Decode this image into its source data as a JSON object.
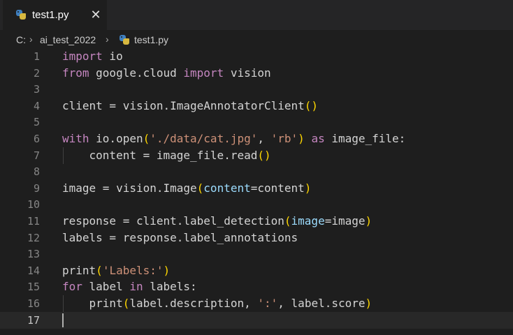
{
  "tab": {
    "label": "test1.py",
    "close_glyph": "✕",
    "icon": "python-file-icon"
  },
  "breadcrumb": {
    "drive": "C:",
    "separator": "›",
    "folder": "ai_test_2022",
    "file": "test1.py"
  },
  "colors": {
    "editor_background": "#1e1e1e",
    "tabbar_background": "#252526",
    "keyword": "#c586c0",
    "string": "#ce9178",
    "bracket": "#ffd700",
    "parameter": "#9cdcfe",
    "line_number": "#858585"
  },
  "editor": {
    "current_line": 17,
    "lines": [
      {
        "n": "1",
        "tokens": [
          {
            "t": "import",
            "c": "kw"
          },
          {
            "t": " io",
            "c": ""
          }
        ]
      },
      {
        "n": "2",
        "tokens": [
          {
            "t": "from",
            "c": "kw"
          },
          {
            "t": " google.cloud ",
            "c": ""
          },
          {
            "t": "import",
            "c": "kw"
          },
          {
            "t": " vision",
            "c": ""
          }
        ]
      },
      {
        "n": "3",
        "tokens": []
      },
      {
        "n": "4",
        "tokens": [
          {
            "t": "client = vision.ImageAnnotatorClient",
            "c": ""
          },
          {
            "t": "()",
            "c": "br"
          }
        ]
      },
      {
        "n": "5",
        "tokens": []
      },
      {
        "n": "6",
        "tokens": [
          {
            "t": "with",
            "c": "kw"
          },
          {
            "t": " io.open",
            "c": ""
          },
          {
            "t": "(",
            "c": "br"
          },
          {
            "t": "'./data/cat.jpg'",
            "c": "str"
          },
          {
            "t": ", ",
            "c": ""
          },
          {
            "t": "'rb'",
            "c": "str"
          },
          {
            "t": ")",
            "c": "br"
          },
          {
            "t": " ",
            "c": ""
          },
          {
            "t": "as",
            "c": "kw"
          },
          {
            "t": " image_file:",
            "c": ""
          }
        ]
      },
      {
        "n": "7",
        "tokens": [
          {
            "t": "    content = image_file.read",
            "c": ""
          },
          {
            "t": "()",
            "c": "br"
          }
        ],
        "guide": true
      },
      {
        "n": "8",
        "tokens": []
      },
      {
        "n": "9",
        "tokens": [
          {
            "t": "image = vision.Image",
            "c": ""
          },
          {
            "t": "(",
            "c": "br"
          },
          {
            "t": "content",
            "c": "id"
          },
          {
            "t": "=content",
            "c": ""
          },
          {
            "t": ")",
            "c": "br"
          }
        ]
      },
      {
        "n": "10",
        "tokens": []
      },
      {
        "n": "11",
        "tokens": [
          {
            "t": "response = client.label_detection",
            "c": ""
          },
          {
            "t": "(",
            "c": "br"
          },
          {
            "t": "image",
            "c": "id"
          },
          {
            "t": "=image",
            "c": ""
          },
          {
            "t": ")",
            "c": "br"
          }
        ]
      },
      {
        "n": "12",
        "tokens": [
          {
            "t": "labels = response.label_annotations",
            "c": ""
          }
        ]
      },
      {
        "n": "13",
        "tokens": []
      },
      {
        "n": "14",
        "tokens": [
          {
            "t": "print",
            "c": ""
          },
          {
            "t": "(",
            "c": "br"
          },
          {
            "t": "'Labels:'",
            "c": "str"
          },
          {
            "t": ")",
            "c": "br"
          }
        ]
      },
      {
        "n": "15",
        "tokens": [
          {
            "t": "for",
            "c": "kw"
          },
          {
            "t": " label ",
            "c": ""
          },
          {
            "t": "in",
            "c": "kw"
          },
          {
            "t": " labels:",
            "c": ""
          }
        ]
      },
      {
        "n": "16",
        "tokens": [
          {
            "t": "    print",
            "c": ""
          },
          {
            "t": "(",
            "c": "br"
          },
          {
            "t": "label.description, ",
            "c": ""
          },
          {
            "t": "':'",
            "c": "str"
          },
          {
            "t": ", label.score",
            "c": ""
          },
          {
            "t": ")",
            "c": "br"
          }
        ],
        "guide": true
      },
      {
        "n": "17",
        "tokens": []
      }
    ]
  }
}
